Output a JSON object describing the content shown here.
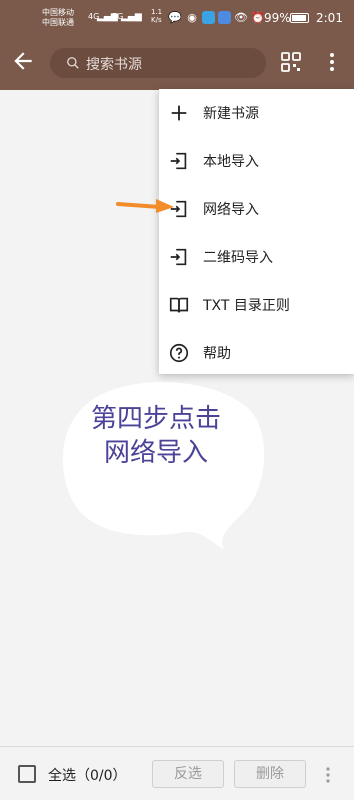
{
  "status_bar": {
    "carrier1": "中国移动",
    "carrier2": "中国联通",
    "net1": "4G",
    "net2": "5G",
    "speed": "1.1 K/s",
    "battery": "99%",
    "time": "2:01"
  },
  "toolbar": {
    "search_placeholder": "搜索书源"
  },
  "menu": {
    "items": [
      {
        "label": "新建书源",
        "icon": "plus-icon"
      },
      {
        "label": "本地导入",
        "icon": "import-icon"
      },
      {
        "label": "网络导入",
        "icon": "import-icon"
      },
      {
        "label": "二维码导入",
        "icon": "import-icon"
      },
      {
        "label": "TXT 目录正则",
        "icon": "book-icon"
      },
      {
        "label": "帮助",
        "icon": "help-icon"
      }
    ]
  },
  "annotation": {
    "text": "第四步点击网络导入"
  },
  "bottom_bar": {
    "select_all": "全选（0/0）",
    "invert": "反选",
    "delete": "删除"
  }
}
